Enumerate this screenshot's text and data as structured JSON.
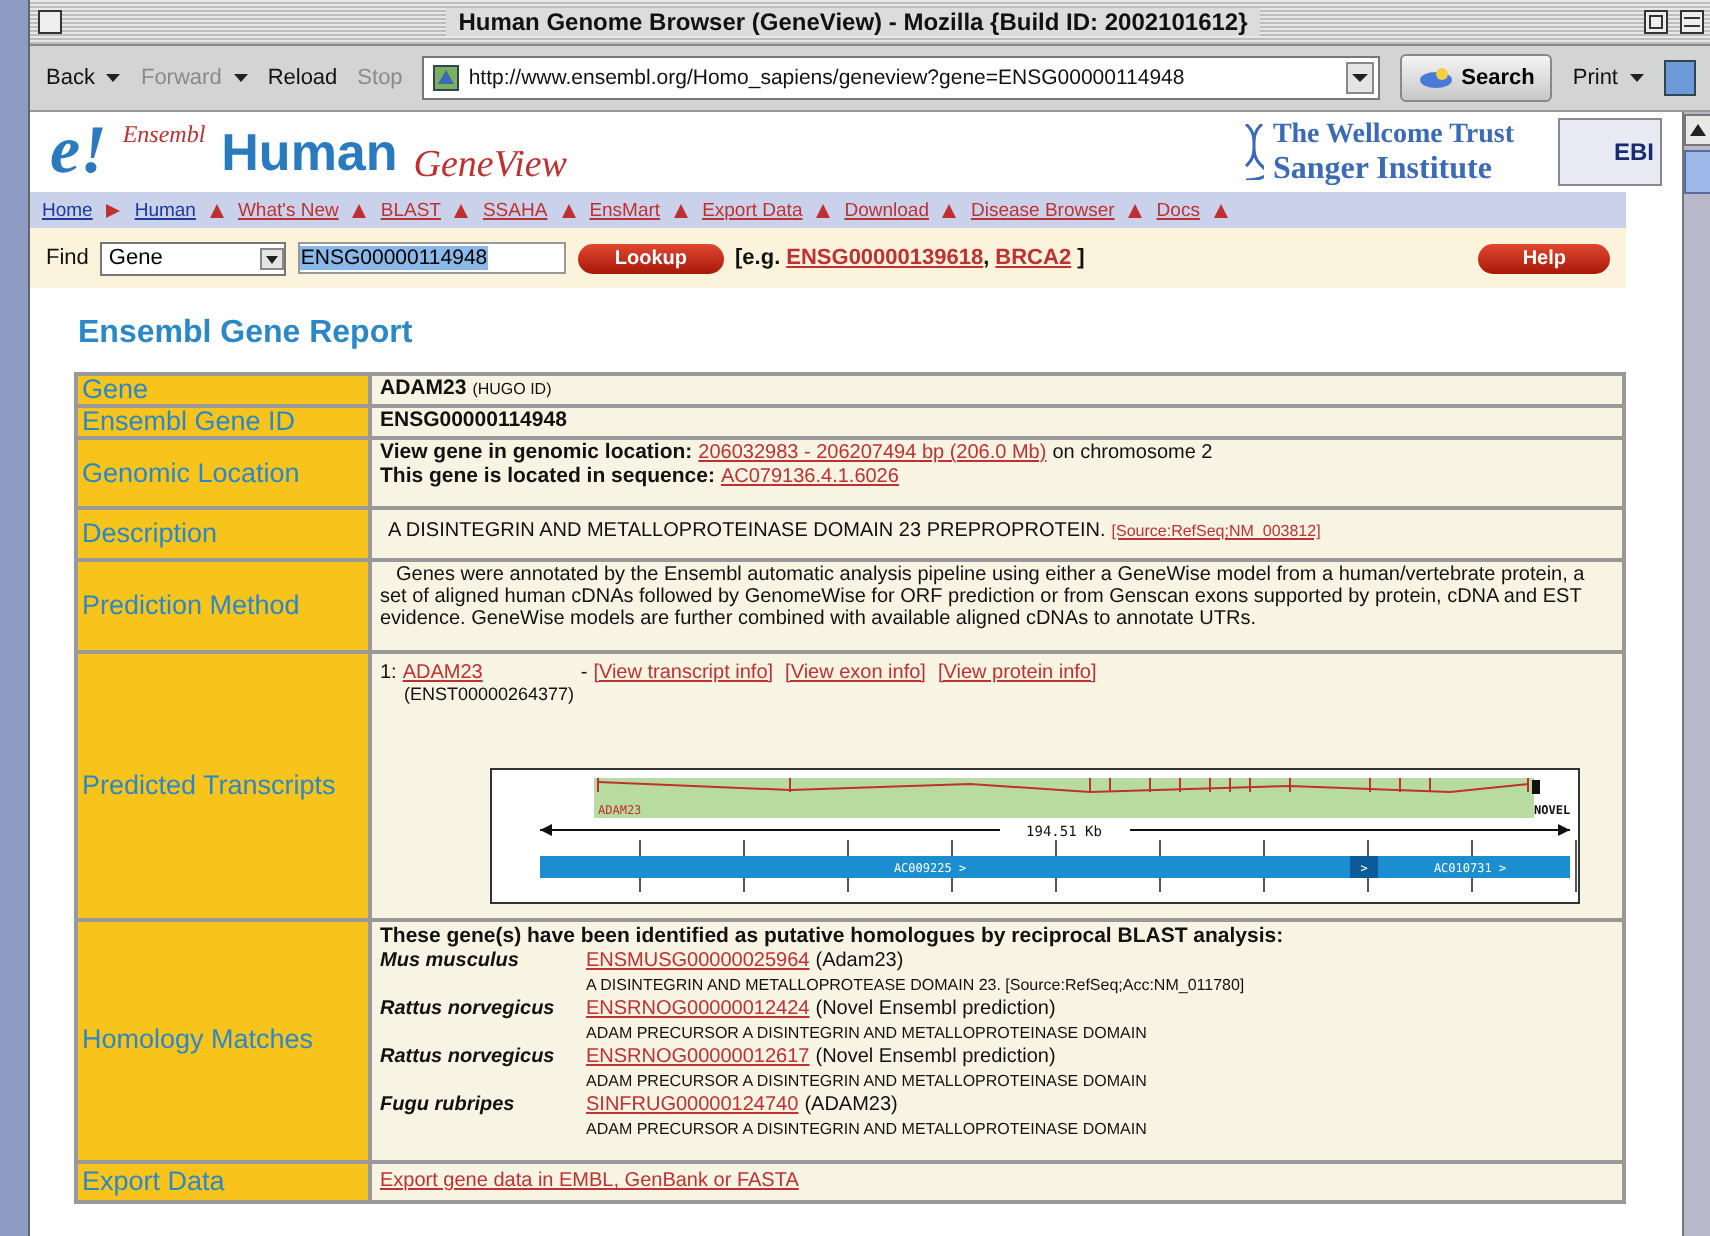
{
  "window": {
    "title": "Human Genome Browser (GeneView) - Mozilla {Build ID: 2002101612}"
  },
  "toolbar": {
    "buttons": [
      {
        "label": "Back",
        "disabled": false,
        "menu": true
      },
      {
        "label": "Forward",
        "disabled": true,
        "menu": true
      },
      {
        "label": "Reload",
        "disabled": false,
        "menu": false
      },
      {
        "label": "Stop",
        "disabled": true,
        "menu": false
      }
    ],
    "url": "http://www.ensembl.org/Homo_sapiens/geneview?gene=ENSG00000114948",
    "search": "Search",
    "print": "Print"
  },
  "banner": {
    "logo": "e!",
    "brand": "Ensembl",
    "species": "Human",
    "view": "GeneView",
    "sanger_line1": "The Wellcome Trust",
    "sanger_line2": "Sanger Institute",
    "ebi": "EBI"
  },
  "nav": [
    {
      "label": "Home",
      "kind": "crumb"
    },
    {
      "label": "Human",
      "kind": "crumb"
    },
    {
      "label": "What's New",
      "kind": "link"
    },
    {
      "label": "BLAST",
      "kind": "link"
    },
    {
      "label": "SSAHA",
      "kind": "link"
    },
    {
      "label": "EnsMart",
      "kind": "link"
    },
    {
      "label": "Export Data",
      "kind": "link"
    },
    {
      "label": "Download",
      "kind": "link"
    },
    {
      "label": "Disease Browser",
      "kind": "link"
    },
    {
      "label": "Docs",
      "kind": "link"
    }
  ],
  "find": {
    "label": "Find",
    "type": "Gene",
    "value": "ENSG00000114948",
    "button": "Lookup",
    "example_open": "[e.g.",
    "examples": [
      "ENSG00000139618",
      "BRCA2"
    ],
    "example_separator": ",",
    "example_close": "]",
    "help": "Help"
  },
  "heading": "Ensembl Gene Report",
  "rows": [
    {
      "label": "Gene",
      "kind": "gene",
      "value": "ADAM23",
      "note": "(HUGO ID)"
    },
    {
      "label": "Ensembl Gene ID",
      "kind": "id",
      "value": "ENSG00000114948"
    },
    {
      "label": "Genomic Location",
      "kind": "location",
      "line1": "View gene in genomic location:",
      "link1": "206032983 - 206207494 bp (206.0 Mb)",
      "after1": "on chromosome 2",
      "line2": "This gene is located in sequence:",
      "link2": "AC079136.4.1.6026"
    },
    {
      "label": "Description",
      "kind": "description",
      "value": "A DISINTEGRIN AND METALLOPROTEINASE DOMAIN 23 PREPROPROTEIN.",
      "source": "[Source:RefSeq;NM_003812]"
    },
    {
      "label": "Prediction Method",
      "kind": "paragraph",
      "value": "Genes were annotated by the Ensembl automatic analysis pipeline using either a GeneWise model from a human/vertebrate protein, a set of aligned human cDNAs followed by GenomeWise for ORF prediction or from Genscan exons supported by protein, cDNA and EST evidence. GeneWise models are further combined with available aligned cDNAs to annotate UTRs."
    },
    {
      "label": "Predicted Transcripts",
      "kind": "transcripts",
      "index": "1:",
      "name": "ADAM23",
      "dash": "-",
      "links": [
        "[View transcript info]",
        "[View exon info]",
        "[View protein info]"
      ],
      "transcript_id": "(ENST00000264377)",
      "diagram": {
        "gene": "ADAM23",
        "status": "NOVEL",
        "length": "194.51 Kb",
        "contigs": [
          "AC009225 >",
          "AC010731 >"
        ],
        "gap": ">"
      }
    },
    {
      "label": "Homology Matches",
      "kind": "homology",
      "intro": "These gene(s) have been identified as putative homologues by reciprocal BLAST analysis:",
      "matches": [
        {
          "species": "Mus musculus",
          "id": "ENSMUSG00000025964",
          "note": "(Adam23)",
          "desc": "A DISINTEGRIN AND METALLOPROTEASE DOMAIN 23. [Source:RefSeq;Acc:NM_011780]"
        },
        {
          "species": "Rattus norvegicus",
          "id": "ENSRNOG00000012424",
          "note": "(Novel Ensembl prediction)",
          "desc": "ADAM PRECURSOR A DISINTEGRIN AND METALLOPROTEINASE DOMAIN"
        },
        {
          "species": "Rattus norvegicus",
          "id": "ENSRNOG00000012617",
          "note": "(Novel Ensembl prediction)",
          "desc": "ADAM PRECURSOR A DISINTEGRIN AND METALLOPROTEINASE DOMAIN"
        },
        {
          "species": "Fugu rubripes",
          "id": "SINFRUG00000124740",
          "note": "(ADAM23)",
          "desc": "ADAM PRECURSOR A DISINTEGRIN AND METALLOPROTEINASE DOMAIN"
        }
      ]
    },
    {
      "label": "Export Data",
      "kind": "export",
      "value": "Export gene data in EMBL, GenBank or FASTA"
    }
  ]
}
